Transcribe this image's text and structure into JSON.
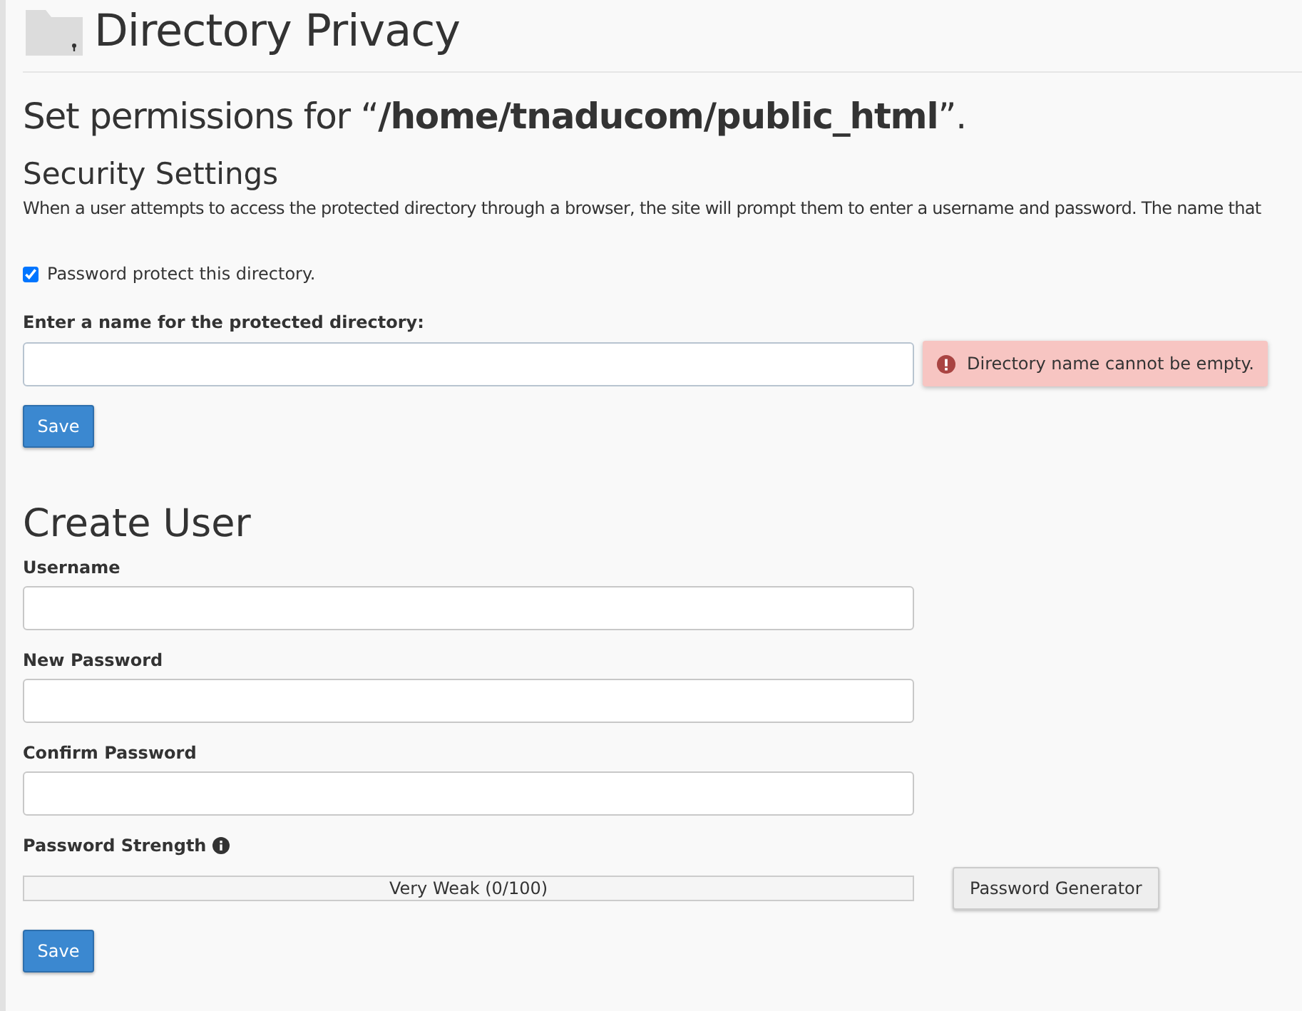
{
  "page": {
    "title": "Directory Privacy"
  },
  "permissions_heading": "Set permissions for “**/home/tnaducom/public_html**”.",
  "security": {
    "heading": "Security Settings",
    "description": "When a user attempts to access the protected directory through a browser, the site will prompt them to enter a username and password. The name that",
    "protect_checkbox": {
      "label": "Password protect this directory.",
      "checked": true
    },
    "name_field": {
      "label": "Enter a name for the protected directory:",
      "error": "Directory name cannot be empty."
    },
    "save_button": "Save"
  },
  "create_user": {
    "heading": "Create User",
    "fields": [
      {
        "label": "Username"
      },
      {
        "label": "New Password"
      },
      {
        "label": "Confirm Password"
      }
    ],
    "strength": {
      "label": "Password Strength",
      "level": 0,
      "reading": "Very Weak (0/100)"
    },
    "generator_button": "Password Generator",
    "save_button": "Save"
  }
}
